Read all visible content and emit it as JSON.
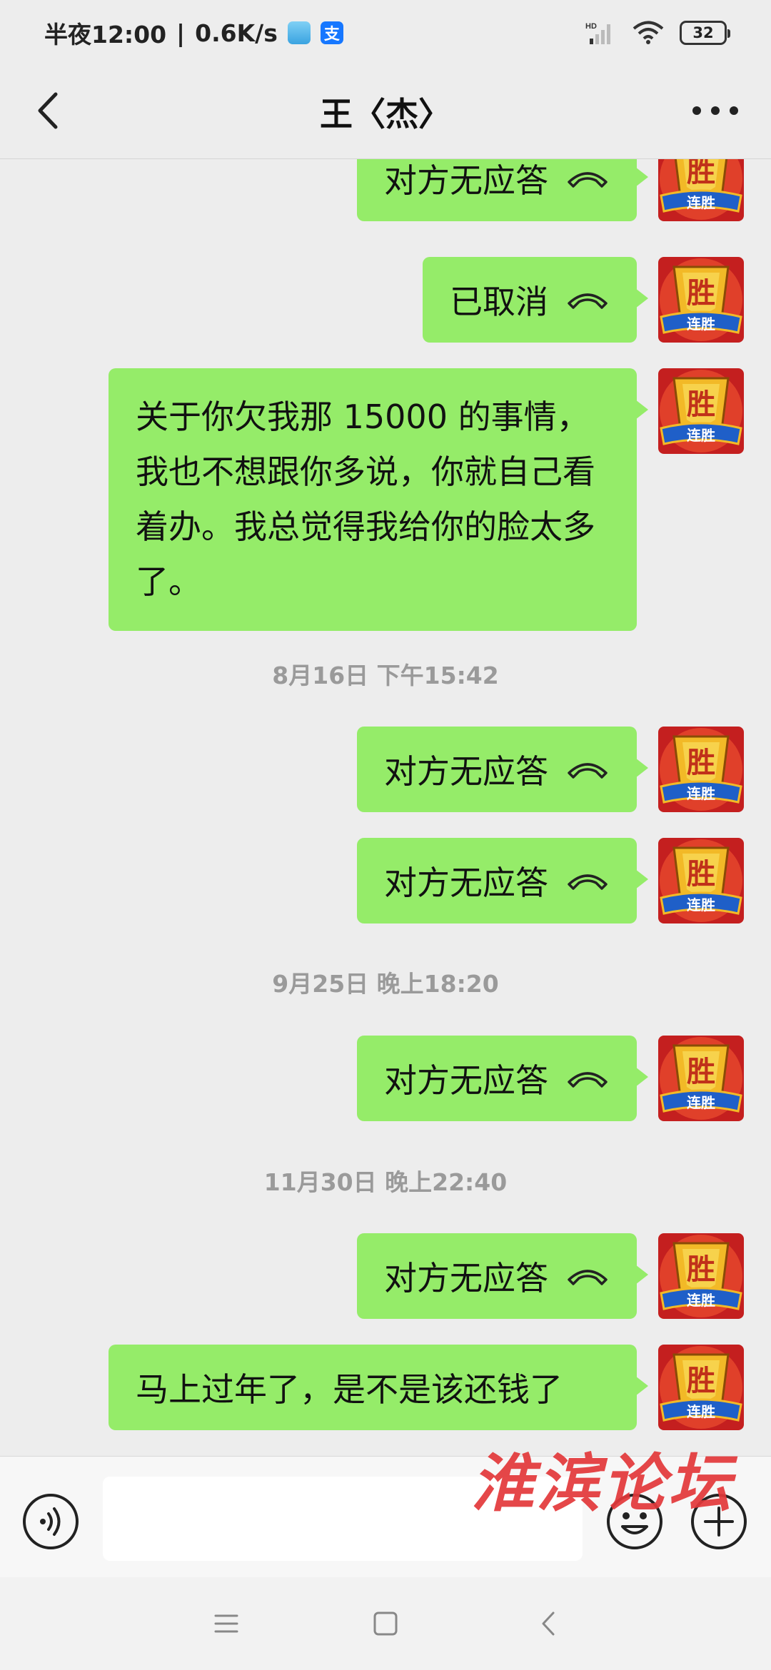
{
  "status_bar": {
    "time": "半夜12:00",
    "net_speed": "0.6K/s",
    "network_type": "HD",
    "battery": "32"
  },
  "header": {
    "title": "王〈杰〉"
  },
  "messages": [
    {
      "type": "call",
      "text": "对方无应答"
    },
    {
      "type": "call",
      "text": "已取消"
    },
    {
      "type": "text",
      "text": "关于你欠我那 15000 的事情，我也不想跟你多说，你就自己看着办。我总觉得我给你的脸太多了。"
    },
    {
      "type": "time",
      "text": "8月16日 下午15:42"
    },
    {
      "type": "call",
      "text": "对方无应答"
    },
    {
      "type": "call",
      "text": "对方无应答"
    },
    {
      "type": "time",
      "text": "9月25日 晚上18:20"
    },
    {
      "type": "call",
      "text": "对方无应答"
    },
    {
      "type": "time",
      "text": "11月30日 晚上22:40"
    },
    {
      "type": "call",
      "text": "对方无应答"
    },
    {
      "type": "text",
      "text": "马上过年了，是不是该还钱了"
    }
  ],
  "avatar": {
    "top_text": "胜",
    "bottom_text": "连胜"
  },
  "input_bar": {
    "value": "",
    "placeholder": ""
  },
  "watermark": "淮滨论坛",
  "colors": {
    "bubble": "#95ec69",
    "background": "#ededed",
    "watermark": "#e3383a"
  }
}
